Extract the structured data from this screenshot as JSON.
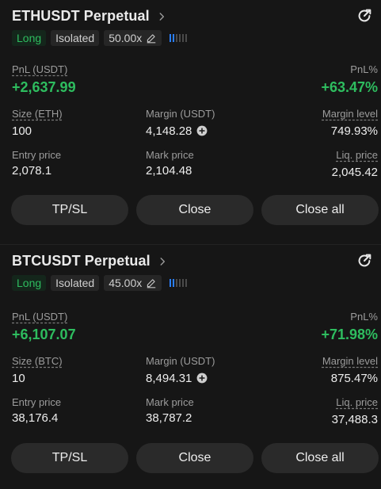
{
  "positions": [
    {
      "symbol": "ETHUSDT Perpetual",
      "side": "Long",
      "margin_mode": "Isolated",
      "leverage": "50.00x",
      "pnl_label": "PnL (USDT)",
      "pnl_value": "+2,637.99",
      "pnl_pct_label": "PnL%",
      "pnl_pct_value": "+63.47%",
      "size_label": "Size (ETH)",
      "size_value": "100",
      "margin_label": "Margin (USDT)",
      "margin_value": "4,148.28",
      "margin_level_label": "Margin level",
      "margin_level_value": "749.93%",
      "entry_label": "Entry price",
      "entry_value": "2,078.1",
      "mark_label": "Mark price",
      "mark_value": "2,104.48",
      "liq_label": "Liq. price",
      "liq_value": "2,045.42",
      "buttons": {
        "tpsl": "TP/SL",
        "close": "Close",
        "close_all": "Close all"
      }
    },
    {
      "symbol": "BTCUSDT Perpetual",
      "side": "Long",
      "margin_mode": "Isolated",
      "leverage": "45.00x",
      "pnl_label": "PnL (USDT)",
      "pnl_value": "+6,107.07",
      "pnl_pct_label": "PnL%",
      "pnl_pct_value": "+71.98%",
      "size_label": "Size (BTC)",
      "size_value": "10",
      "margin_label": "Margin (USDT)",
      "margin_value": "8,494.31",
      "margin_level_label": "Margin level",
      "margin_level_value": "875.47%",
      "entry_label": "Entry price",
      "entry_value": "38,176.4",
      "mark_label": "Mark price",
      "mark_value": "38,787.2",
      "liq_label": "Liq. price",
      "liq_value": "37,488.3",
      "buttons": {
        "tpsl": "TP/SL",
        "close": "Close",
        "close_all": "Close all"
      }
    }
  ],
  "colors": {
    "profit": "#2ebd5f",
    "risk_indicator": "#2a7fff",
    "background": "#161616"
  },
  "icons": {
    "chevron": "chevron-right-icon",
    "share": "share-icon",
    "edit": "edit-pencil-icon",
    "add": "add-margin-icon"
  }
}
